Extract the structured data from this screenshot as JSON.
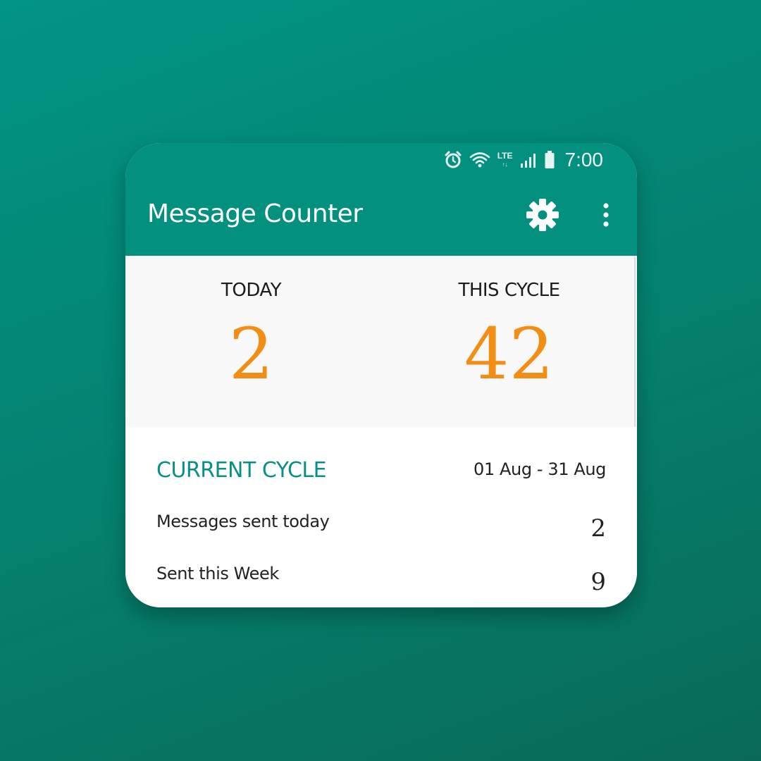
{
  "status_bar": {
    "time": "7:00",
    "network": "LTE",
    "icons": [
      "alarm-icon",
      "wifi-icon",
      "lte-icon",
      "signal-icon",
      "battery-icon"
    ]
  },
  "app_bar": {
    "title": "Message Counter",
    "settings_icon": "gear-icon",
    "menu_icon": "more-vertical-icon"
  },
  "summary": {
    "today_label": "TODAY",
    "today_value": "2",
    "cycle_label": "THIS CYCLE",
    "cycle_value": "42"
  },
  "current_cycle": {
    "heading": "CURRENT CYCLE",
    "range": "01 Aug - 31 Aug",
    "rows": [
      {
        "label": "Messages sent today",
        "value": "2"
      },
      {
        "label": "Sent this Week",
        "value": "9"
      }
    ]
  },
  "colors": {
    "background": "#04826f",
    "app_bar": "#03907f",
    "accent_orange": "#f28e13",
    "accent_teal": "#079083"
  }
}
